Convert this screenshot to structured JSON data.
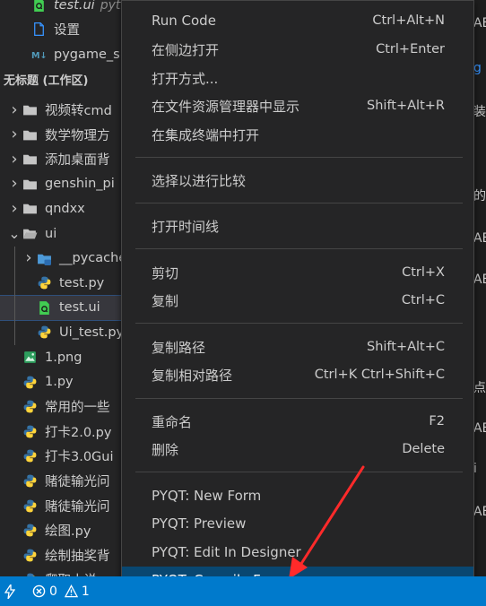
{
  "explorer": {
    "section_title": "无标题 (工作区)",
    "top_items": [
      {
        "label": "test.ui",
        "suffix": "pyth",
        "icon": "qt-ui-file-icon"
      },
      {
        "label": "设置",
        "icon": "file-icon"
      },
      {
        "label": "pygame_sn",
        "icon": "markdown-icon"
      }
    ],
    "tree": [
      {
        "label": "视频转cmd",
        "type": "folder",
        "expanded": false
      },
      {
        "label": "数学物理方",
        "type": "folder",
        "expanded": false
      },
      {
        "label": "添加桌面背",
        "type": "folder",
        "expanded": false
      },
      {
        "label": "genshin_pi",
        "type": "folder",
        "expanded": false
      },
      {
        "label": "qndxx",
        "type": "folder",
        "expanded": false
      },
      {
        "label": "ui",
        "type": "folder",
        "expanded": true
      },
      {
        "label": "__pycache",
        "type": "folder",
        "expanded": false
      },
      {
        "label": "test.py",
        "type": "python"
      },
      {
        "label": "test.ui",
        "type": "qtui",
        "selected": true
      },
      {
        "label": "Ui_test.py",
        "type": "python"
      },
      {
        "label": "1.png",
        "type": "image"
      },
      {
        "label": "1.py",
        "type": "python"
      },
      {
        "label": "常用的一些",
        "type": "python"
      },
      {
        "label": "打卡2.0.py",
        "type": "python"
      },
      {
        "label": "打卡3.0Gui",
        "type": "python"
      },
      {
        "label": "赌徒输光问",
        "type": "python"
      },
      {
        "label": "赌徒输光问",
        "type": "python"
      },
      {
        "label": "绘图.py",
        "type": "python"
      },
      {
        "label": "绘制抽奖背",
        "type": "python"
      },
      {
        "label": "爬取小说",
        "type": "python"
      }
    ]
  },
  "context_menu": {
    "groups": [
      [
        {
          "label": "Run Code",
          "shortcut": "Ctrl+Alt+N"
        },
        {
          "label": "在侧边打开",
          "shortcut": "Ctrl+Enter"
        },
        {
          "label": "打开方式...",
          "shortcut": ""
        },
        {
          "label": "在文件资源管理器中显示",
          "shortcut": "Shift+Alt+R"
        },
        {
          "label": "在集成终端中打开",
          "shortcut": ""
        }
      ],
      [
        {
          "label": "选择以进行比较",
          "shortcut": ""
        }
      ],
      [
        {
          "label": "打开时间线",
          "shortcut": ""
        }
      ],
      [
        {
          "label": "剪切",
          "shortcut": "Ctrl+X"
        },
        {
          "label": "复制",
          "shortcut": "Ctrl+C"
        }
      ],
      [
        {
          "label": "复制路径",
          "shortcut": "Shift+Alt+C"
        },
        {
          "label": "复制相对路径",
          "shortcut": "Ctrl+K Ctrl+Shift+C"
        }
      ],
      [
        {
          "label": "重命名",
          "shortcut": "F2"
        },
        {
          "label": "删除",
          "shortcut": "Delete"
        }
      ],
      [
        {
          "label": "PYQT: New Form",
          "shortcut": ""
        },
        {
          "label": "PYQT: Preview",
          "shortcut": ""
        },
        {
          "label": "PYQT: Edit In Designer",
          "shortcut": ""
        },
        {
          "label": "PYQT: Compile Form",
          "shortcut": "",
          "active": true
        }
      ]
    ]
  },
  "editor_fragments": [
    {
      "text": "AE",
      "color": "#cccccc"
    },
    {
      "text": "g",
      "color": "#3794ff"
    },
    {
      "text": "装",
      "color": "#cccccc"
    },
    {
      "text": "的",
      "color": "#cccccc"
    },
    {
      "text": "AE",
      "color": "#cccccc"
    },
    {
      "text": "AE",
      "color": "#cccccc"
    },
    {
      "text": "点",
      "color": "#cccccc"
    },
    {
      "text": "AE",
      "color": "#cccccc"
    },
    {
      "text": "i",
      "color": "#cccccc"
    },
    {
      "text": "AE",
      "color": "#cccccc"
    }
  ],
  "status_bar": {
    "errors": "0",
    "warnings": "1"
  },
  "colors": {
    "accent": "#007acc",
    "menu_highlight": "#094771",
    "folder": "#c5c5c5",
    "python_blue": "#3572a5",
    "python_yellow": "#ffd43b",
    "qt_green": "#41cd52",
    "annotation_red": "#ff2a2a"
  }
}
